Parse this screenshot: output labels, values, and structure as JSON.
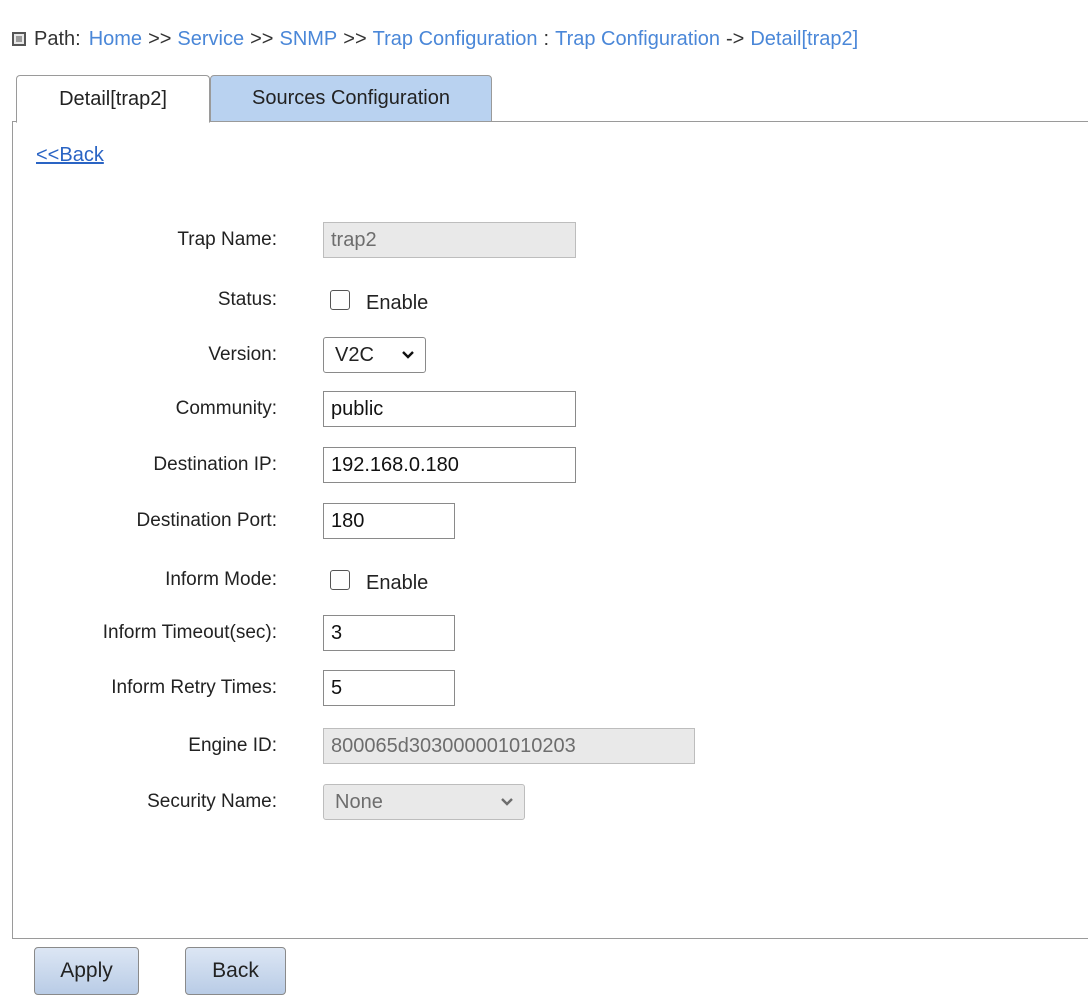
{
  "path": {
    "label": "Path:",
    "crumbs": [
      "Home",
      "Service",
      "SNMP",
      "Trap Configuration",
      "Trap Configuration",
      "Detail[trap2]"
    ],
    "separators": [
      ">>",
      ">>",
      ">>",
      ":",
      "->"
    ]
  },
  "tabs": [
    {
      "label": "Detail[trap2]",
      "active": true
    },
    {
      "label": "Sources Configuration",
      "active": false
    }
  ],
  "back_link": "<<Back",
  "form": {
    "trap_name": {
      "label": "Trap Name:",
      "value": "trap2"
    },
    "status": {
      "label": "Status:",
      "checkbox_label": "Enable",
      "checked": false
    },
    "version": {
      "label": "Version:",
      "value": "V2C"
    },
    "community": {
      "label": "Community:",
      "value": "public"
    },
    "destination_ip": {
      "label": "Destination IP:",
      "value": "192.168.0.180"
    },
    "destination_port": {
      "label": "Destination Port:",
      "value": "180"
    },
    "inform_mode": {
      "label": "Inform Mode:",
      "checkbox_label": "Enable",
      "checked": false
    },
    "inform_timeout": {
      "label": "Inform Timeout(sec):",
      "value": "3"
    },
    "inform_retry": {
      "label": "Inform Retry Times:",
      "value": "5"
    },
    "engine_id": {
      "label": "Engine ID:",
      "value": "800065d303000001010203"
    },
    "security_name": {
      "label": "Security Name:",
      "value": "None"
    }
  },
  "buttons": {
    "apply": "Apply",
    "back": "Back"
  },
  "colors": {
    "link": "#4a87d8",
    "inactive_tab": "#b9d2f0",
    "button": "#c9d9ee"
  }
}
